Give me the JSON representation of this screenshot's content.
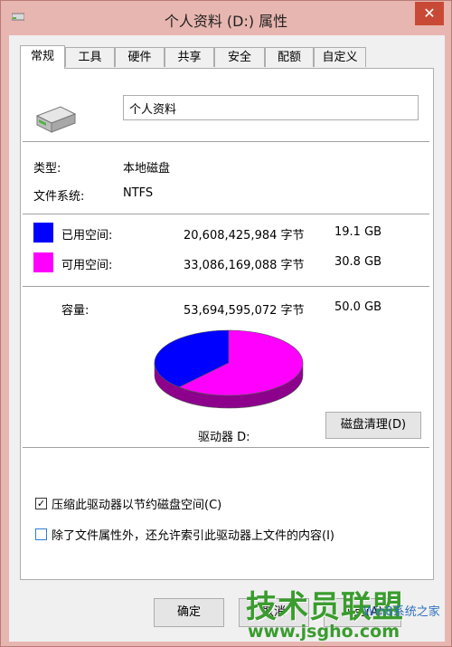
{
  "window": {
    "title": "个人资料 (D:) 属性",
    "close_symbol": "✕"
  },
  "tabs": [
    {
      "label": "常规",
      "active": true
    },
    {
      "label": "工具"
    },
    {
      "label": "硬件"
    },
    {
      "label": "共享"
    },
    {
      "label": "安全"
    },
    {
      "label": "配额"
    },
    {
      "label": "自定义"
    }
  ],
  "general": {
    "drive_icon": "hard-drive-icon",
    "drive_name": "个人资料",
    "type_label": "类型:",
    "type_value": "本地磁盘",
    "fs_label": "文件系统:",
    "fs_value": "NTFS",
    "used": {
      "label": "已用空间:",
      "bytes": "20,608,425,984 字节",
      "size": "19.1 GB",
      "color": "#0000ff"
    },
    "free": {
      "label": "可用空间:",
      "bytes": "33,086,169,088 字节",
      "size": "30.8 GB",
      "color": "#ff00ff"
    },
    "capacity": {
      "label": "容量:",
      "bytes": "53,694,595,072 字节",
      "size": "50.0 GB"
    },
    "drive_label": "驱动器 D:",
    "cleanup_button": "磁盘清理(D)",
    "compress_label": "压缩此驱动器以节约磁盘空间(C)",
    "compress_checked": true,
    "index_label": "除了文件属性外，还允许索引此驱动器上文件的内容(I)",
    "index_checked": false
  },
  "chart_data": {
    "type": "pie",
    "categories": [
      "已用空间",
      "可用空间"
    ],
    "values": [
      20608425984,
      33086169088
    ],
    "colors": [
      "#0000ff",
      "#ff00ff"
    ]
  },
  "buttons": {
    "ok": "确定",
    "cancel": "取消",
    "apply": "应用(A)"
  },
  "watermark": {
    "brand": "技术员联盟",
    "url": "www.jsgho.com",
    "sub": "Win8系统之家"
  }
}
